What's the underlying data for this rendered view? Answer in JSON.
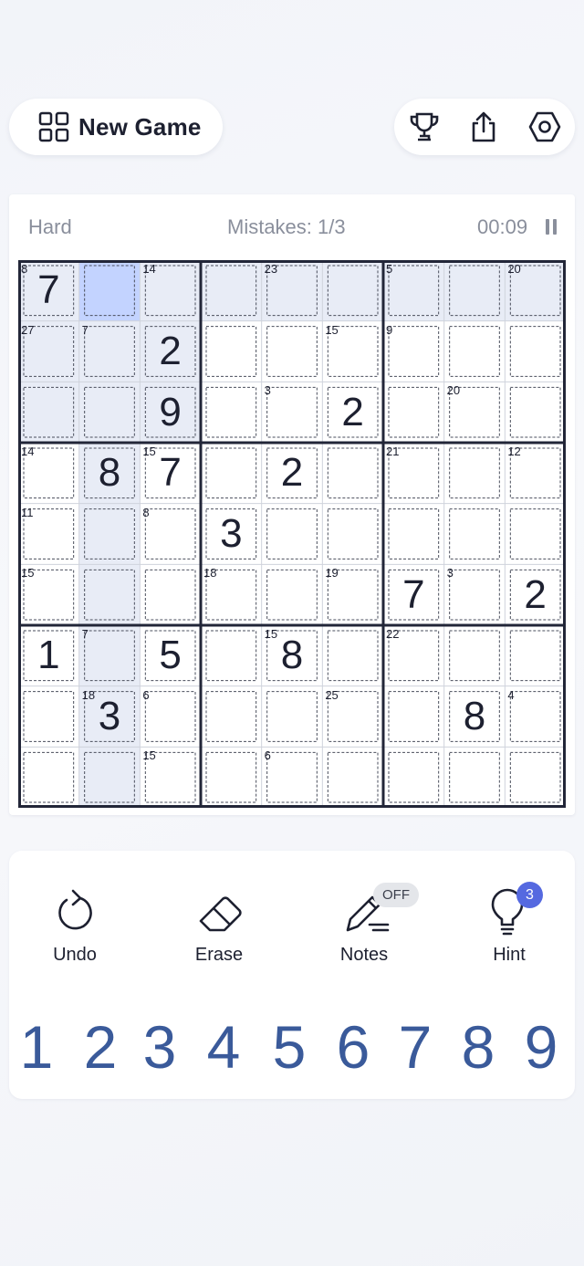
{
  "header": {
    "new_game_label": "New Game",
    "icons": [
      "grid-icon",
      "trophy-icon",
      "share-icon",
      "settings-icon"
    ]
  },
  "status": {
    "difficulty": "Hard",
    "mistakes": "Mistakes: 1/3",
    "timer": "00:09"
  },
  "board": {
    "selected": [
      0,
      1
    ],
    "given": [
      [
        7,
        0,
        0,
        0,
        0,
        0,
        0,
        0,
        0
      ],
      [
        0,
        0,
        2,
        0,
        0,
        0,
        0,
        0,
        0
      ],
      [
        0,
        0,
        9,
        0,
        0,
        2,
        0,
        0,
        0
      ],
      [
        0,
        8,
        7,
        0,
        2,
        0,
        0,
        0,
        0
      ],
      [
        0,
        0,
        0,
        3,
        0,
        0,
        0,
        0,
        0
      ],
      [
        0,
        0,
        0,
        0,
        0,
        0,
        7,
        0,
        2
      ],
      [
        1,
        0,
        5,
        0,
        8,
        0,
        0,
        0,
        0
      ],
      [
        0,
        3,
        0,
        0,
        0,
        0,
        0,
        8,
        0
      ],
      [
        0,
        0,
        0,
        0,
        0,
        0,
        0,
        0,
        0
      ]
    ],
    "cage_sums": [
      {
        "r": 0,
        "c": 0,
        "v": "8"
      },
      {
        "r": 0,
        "c": 2,
        "v": "14"
      },
      {
        "r": 0,
        "c": 4,
        "v": "23"
      },
      {
        "r": 0,
        "c": 6,
        "v": "5"
      },
      {
        "r": 0,
        "c": 8,
        "v": "20"
      },
      {
        "r": 1,
        "c": 0,
        "v": "27"
      },
      {
        "r": 1,
        "c": 1,
        "v": "7"
      },
      {
        "r": 1,
        "c": 5,
        "v": "15"
      },
      {
        "r": 1,
        "c": 6,
        "v": "9"
      },
      {
        "r": 2,
        "c": 4,
        "v": "3"
      },
      {
        "r": 2,
        "c": 7,
        "v": "20"
      },
      {
        "r": 3,
        "c": 0,
        "v": "14"
      },
      {
        "r": 3,
        "c": 2,
        "v": "15"
      },
      {
        "r": 3,
        "c": 6,
        "v": "21"
      },
      {
        "r": 3,
        "c": 8,
        "v": "12"
      },
      {
        "r": 4,
        "c": 0,
        "v": "11"
      },
      {
        "r": 4,
        "c": 2,
        "v": "8"
      },
      {
        "r": 5,
        "c": 0,
        "v": "15"
      },
      {
        "r": 5,
        "c": 3,
        "v": "18"
      },
      {
        "r": 5,
        "c": 5,
        "v": "19"
      },
      {
        "r": 5,
        "c": 7,
        "v": "3"
      },
      {
        "r": 6,
        "c": 1,
        "v": "7"
      },
      {
        "r": 6,
        "c": 4,
        "v": "15"
      },
      {
        "r": 6,
        "c": 6,
        "v": "22"
      },
      {
        "r": 7,
        "c": 1,
        "v": "18"
      },
      {
        "r": 7,
        "c": 2,
        "v": "6"
      },
      {
        "r": 7,
        "c": 5,
        "v": "25"
      },
      {
        "r": 7,
        "c": 8,
        "v": "4"
      },
      {
        "r": 8,
        "c": 2,
        "v": "15"
      },
      {
        "r": 8,
        "c": 4,
        "v": "6"
      }
    ]
  },
  "controls": [
    {
      "label": "Undo",
      "icon": "undo-icon"
    },
    {
      "label": "Erase",
      "icon": "eraser-icon"
    },
    {
      "label": "Notes",
      "icon": "pencil-icon"
    },
    {
      "label": "Hint",
      "icon": "lightbulb-icon"
    }
  ],
  "notes_state": "OFF",
  "hint_count": "3",
  "numbers": [
    "1",
    "2",
    "3",
    "4",
    "5",
    "6",
    "7",
    "8",
    "9"
  ],
  "colors": {
    "selected": "#c3d3ff",
    "highlight": "#e8ecf6",
    "thick_line": "#222638",
    "thin_line": "#cfd3dc",
    "number_pad": "#3a5a9a",
    "hint_badge": "#5569e0"
  }
}
